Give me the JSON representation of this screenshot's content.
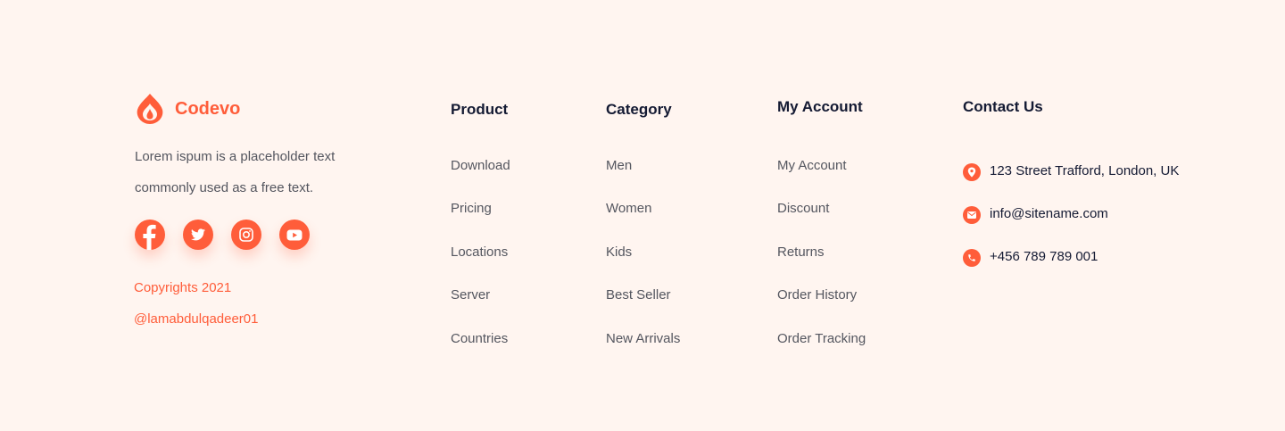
{
  "brand": {
    "name": "Codevo",
    "logo_icon": "flame-icon",
    "description": "Lorem ispum is a placeholder text commonly used as a free text.",
    "accent_color": "#ff5d3a"
  },
  "socials": [
    {
      "name": "facebook",
      "icon": "facebook-icon"
    },
    {
      "name": "twitter",
      "icon": "twitter-icon"
    },
    {
      "name": "instagram",
      "icon": "instagram-icon"
    },
    {
      "name": "youtube",
      "icon": "youtube-icon"
    }
  ],
  "copyright": {
    "line1": "Copyrights 2021",
    "line2": "@lamabdulqadeer01"
  },
  "columns": {
    "product": {
      "title": "Product",
      "items": [
        "Download",
        "Pricing",
        "Locations",
        "Server",
        "Countries"
      ]
    },
    "category": {
      "title": "Category",
      "items": [
        "Men",
        "Women",
        "Kids",
        "Best Seller",
        "New Arrivals"
      ]
    },
    "account": {
      "title": "My Account",
      "items": [
        "My Account",
        "Discount",
        "Returns",
        "Order History",
        "Order Tracking"
      ]
    }
  },
  "contact": {
    "title": "Contact Us",
    "address": "123 Street Trafford, London, UK",
    "email": "info@sitename.com",
    "phone": "+456 789 789 001"
  }
}
